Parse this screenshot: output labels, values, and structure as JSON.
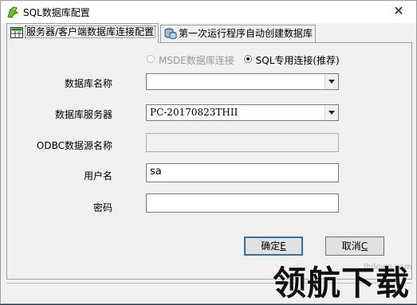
{
  "window": {
    "title": "SQL数据库配置",
    "close": "✕"
  },
  "tabs": [
    {
      "label": "服务器/客户端数据库连接配置"
    },
    {
      "label": "第一次运行程序自动创建数据库"
    }
  ],
  "connection_type": {
    "option1": "MSDE数据库连接",
    "option2": "SQL专用连接(推荐)"
  },
  "form": {
    "db_name_label": "数据库名称",
    "db_name_value": "",
    "server_label": "数据库服务器",
    "server_value": "PC-20170823THII",
    "odbc_label": "ODBC数据源名称",
    "odbc_value": "",
    "user_label": "用户名",
    "user_value": "sa",
    "password_label": "密码",
    "password_value": ""
  },
  "buttons": {
    "ok": "确定",
    "ok_key": "E",
    "cancel": "取消",
    "cancel_key": "C"
  },
  "watermark": {
    "text": "领航下载",
    "url": "lhdown.com"
  }
}
